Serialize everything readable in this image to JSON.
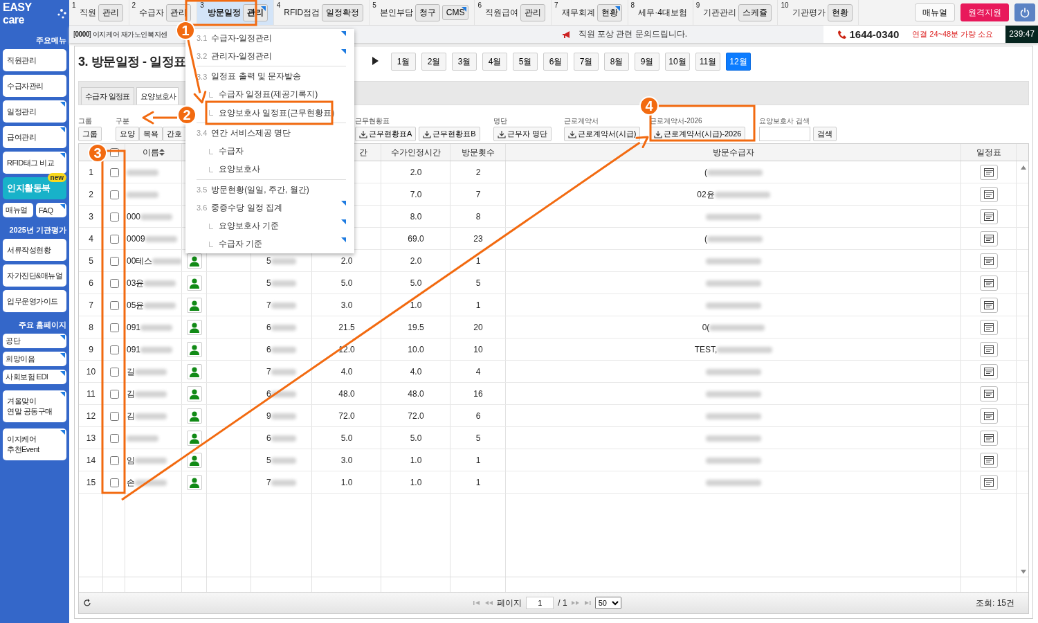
{
  "sidebar": {
    "logo": "EASY care",
    "items": [
      {
        "kind": "heading",
        "label": "주요메뉴"
      },
      {
        "kind": "item",
        "label": "직원관리",
        "marked": false
      },
      {
        "kind": "item",
        "label": "수급자관리",
        "marked": false
      },
      {
        "kind": "item",
        "label": "일정관리",
        "marked": true
      },
      {
        "kind": "item",
        "label": "급여관리",
        "marked": true
      },
      {
        "kind": "item",
        "label": "RFID태그 비교",
        "marked": true
      },
      {
        "kind": "feature",
        "label": "인지활동북",
        "badge": "new"
      },
      {
        "kind": "pair",
        "items": [
          {
            "label": "매뉴얼",
            "marked": false
          },
          {
            "label": "FAQ",
            "marked": true
          }
        ]
      },
      {
        "kind": "heading",
        "label": "2025년 기관평가"
      },
      {
        "kind": "item",
        "label": "서류작성현황",
        "marked": false
      },
      {
        "kind": "item",
        "label": "자가진단&매뉴얼",
        "marked": false
      },
      {
        "kind": "item",
        "label": "업무운영가이드",
        "marked": false
      },
      {
        "kind": "heading",
        "label": "주요 홈페이지"
      },
      {
        "kind": "small",
        "label": "공단",
        "marked": true
      },
      {
        "kind": "small",
        "label": "희망이음",
        "marked": true
      },
      {
        "kind": "small",
        "label": "사회보험 EDI",
        "marked": true
      },
      {
        "kind": "tall",
        "label": "겨울맞이\n연말 공동구매",
        "marked": true
      },
      {
        "kind": "tall",
        "label": "이지케어\n추천Event",
        "marked": true
      }
    ]
  },
  "top_nav": {
    "groups": [
      {
        "number": "1",
        "label": "직원",
        "selected": false,
        "buttons": [
          {
            "label": "관리",
            "marked": false
          }
        ]
      },
      {
        "number": "2",
        "label": "수급자",
        "selected": false,
        "buttons": [
          {
            "label": "관리",
            "marked": false
          }
        ]
      },
      {
        "number": "3",
        "label": "방문일정",
        "selected": true,
        "buttons": [
          {
            "label": "관리",
            "marked": true
          }
        ]
      },
      {
        "number": "4",
        "label": "RFID점검",
        "selected": false,
        "buttons": [
          {
            "label": "일정확정",
            "marked": false
          }
        ]
      },
      {
        "number": "5",
        "label": "본인부담",
        "selected": false,
        "buttons": [
          {
            "label": "청구",
            "marked": false
          },
          {
            "label": "CMS",
            "marked": true
          }
        ]
      },
      {
        "number": "6",
        "label": "직원급여",
        "selected": false,
        "buttons": [
          {
            "label": "관리",
            "marked": false
          }
        ]
      },
      {
        "number": "7",
        "label": "재무회계",
        "selected": false,
        "buttons": [
          {
            "label": "현황",
            "marked": true
          }
        ]
      },
      {
        "number": "8",
        "label": "세무·4대보험",
        "selected": false
      },
      {
        "number": "9",
        "label": "기관관리",
        "selected": false,
        "buttons": [
          {
            "label": "스케쥴",
            "marked": false
          }
        ]
      },
      {
        "number": "10",
        "label": "기관평가",
        "selected": false,
        "buttons": [
          {
            "label": "현황",
            "marked": false
          }
        ]
      }
    ],
    "actions": [
      {
        "kind": "plain",
        "label": "매뉴얼"
      },
      {
        "kind": "alert",
        "label": "원격지원"
      },
      {
        "kind": "power"
      }
    ]
  },
  "info_bar": {
    "center": "[**0000**] 이지케어 재가노인복지센",
    "notice": "직원 포상 관련 문의드립니다.",
    "phone": "1644-0340",
    "phone_note": "연결 24~48분 가량 소요",
    "timer": "239:47"
  },
  "page": {
    "title": "3. 방문일정 - 일정표",
    "months": [
      {
        "label": "1월",
        "selected": false
      },
      {
        "label": "2월",
        "selected": false
      },
      {
        "label": "3월",
        "selected": false
      },
      {
        "label": "4월",
        "selected": false
      },
      {
        "label": "5월",
        "selected": false
      },
      {
        "label": "6월",
        "selected": false
      },
      {
        "label": "7월",
        "selected": false
      },
      {
        "label": "8월",
        "selected": false
      },
      {
        "label": "9월",
        "selected": false
      },
      {
        "label": "10월",
        "selected": false
      },
      {
        "label": "11월",
        "selected": false
      },
      {
        "label": "12월",
        "selected": true
      }
    ]
  },
  "tabs": [
    {
      "label": "수급자 일정표",
      "selected": false
    },
    {
      "label": "요양보호사",
      "selected": true
    }
  ],
  "filters": [
    {
      "kind": "buttons",
      "label": "그룹",
      "buttons": [
        "그룹"
      ]
    },
    {
      "kind": "buttons",
      "label": "구분",
      "buttons": [
        "요양",
        "목욕",
        "간호"
      ]
    },
    {
      "kind": "download",
      "label": "근무현황표",
      "buttons": [
        "근무현황표A",
        "근무현황표B"
      ]
    },
    {
      "kind": "download",
      "label": "명단",
      "buttons": [
        "근무자 명단"
      ]
    },
    {
      "kind": "download",
      "label": "근로계약서",
      "buttons": [
        "근로계약서(시급)"
      ]
    },
    {
      "kind": "download",
      "label": "근로계약서-2026",
      "buttons": [
        "근로계약서(시급)-2026"
      ]
    },
    {
      "kind": "search",
      "label": "요양보호사 검색",
      "buttons": [
        "검색"
      ]
    }
  ],
  "table": {
    "select_all": false,
    "header": {
      "name": "이름",
      "hours": "간",
      "approved_hours": "수가인정시간",
      "visits": "방문횟수",
      "recipient": "방문수급자",
      "schedule": "일정표"
    },
    "rows": [
      {
        "number": "1",
        "checked": false,
        "approved_hours": "2.0",
        "visits": "2",
        "recipient": "("
      },
      {
        "number": "2",
        "checked": false,
        "approved_hours": "7.0",
        "visits": "7",
        "recipient": "02윤"
      },
      {
        "number": "3",
        "checked": false,
        "name": "000",
        "approved_hours": "8.0",
        "visits": "8"
      },
      {
        "number": "4",
        "checked": false,
        "name": "0009",
        "approved_hours": "69.0",
        "visits": "23",
        "recipient": "("
      },
      {
        "number": "5",
        "checked": false,
        "name": "00테스",
        "column_5": "5",
        "hours": "2.0",
        "approved_hours": "2.0",
        "visits": "1"
      },
      {
        "number": "6",
        "checked": false,
        "name": "03윤",
        "column_5": "5",
        "hours": "5.0",
        "approved_hours": "5.0",
        "visits": "5"
      },
      {
        "number": "7",
        "checked": false,
        "name": "05윤",
        "column_5": "7",
        "hours": "3.0",
        "approved_hours": "1.0",
        "visits": "1"
      },
      {
        "number": "8",
        "checked": false,
        "name": "091",
        "column_5": "6",
        "hours": "21.5",
        "approved_hours": "19.5",
        "visits": "20",
        "recipient": "0("
      },
      {
        "number": "9",
        "checked": false,
        "name": "091",
        "column_5": "6",
        "hours": "12.0",
        "approved_hours": "10.0",
        "visits": "10",
        "recipient": "TEST,"
      },
      {
        "number": "10",
        "checked": false,
        "name": "길",
        "column_5": "7",
        "hours": "4.0",
        "approved_hours": "4.0",
        "visits": "4"
      },
      {
        "number": "11",
        "checked": false,
        "name": "김",
        "column_5": "6",
        "hours": "48.0",
        "approved_hours": "48.0",
        "visits": "16"
      },
      {
        "number": "12",
        "checked": false,
        "name": "김",
        "column_5": "9",
        "hours": "72.0",
        "approved_hours": "72.0",
        "visits": "6"
      },
      {
        "number": "13",
        "checked": false,
        "column_5": "6",
        "hours": "5.0",
        "approved_hours": "5.0",
        "visits": "5"
      },
      {
        "number": "14",
        "checked": false,
        "name": "임",
        "column_5": "5",
        "hours": "3.0",
        "approved_hours": "1.0",
        "visits": "1"
      },
      {
        "number": "15",
        "checked": false,
        "name": "손",
        "column_5": "7",
        "hours": "1.0",
        "approved_hours": "1.0",
        "visits": "1"
      }
    ]
  },
  "pager": {
    "page_label": "페이지",
    "page": "1",
    "total": "/ 1",
    "page_size": "50",
    "count": "조회: 15건"
  },
  "menu": {
    "items": [
      {
        "kind": "section",
        "number": "3.1",
        "label": "수급자-일정관리",
        "marked": true
      },
      {
        "kind": "section",
        "number": "3.2",
        "label": "관리자-일정관리",
        "marked": true
      },
      {
        "kind": "divider"
      },
      {
        "kind": "section",
        "number": "3.3",
        "label": "일정표 출력 및 문자발송",
        "marked": false
      },
      {
        "kind": "sub",
        "label": "수급자 일정표(제공기록지)",
        "marked": false
      },
      {
        "kind": "sub",
        "label": "요양보호사 일정표(근무현황표)",
        "marked": false
      },
      {
        "kind": "divider"
      },
      {
        "kind": "section",
        "number": "3.4",
        "label": "연간 서비스제공 명단",
        "marked": false
      },
      {
        "kind": "sub",
        "label": "수급자",
        "marked": false
      },
      {
        "kind": "sub",
        "label": "요양보호사",
        "marked": false
      },
      {
        "kind": "divider"
      },
      {
        "kind": "section",
        "number": "3.5",
        "label": "방문현황(일일, 주간, 월간)",
        "marked": false
      },
      {
        "kind": "section",
        "number": "3.6",
        "label": "중증수당 일정 집계",
        "marked": true
      },
      {
        "kind": "sub",
        "label": "요양보호사 기준",
        "marked": true
      },
      {
        "kind": "sub",
        "label": "수급자 기준",
        "marked": true
      }
    ]
  },
  "annotations": [
    {
      "number": "1"
    },
    {
      "number": "2"
    },
    {
      "number": "3"
    },
    {
      "number": "4"
    }
  ]
}
